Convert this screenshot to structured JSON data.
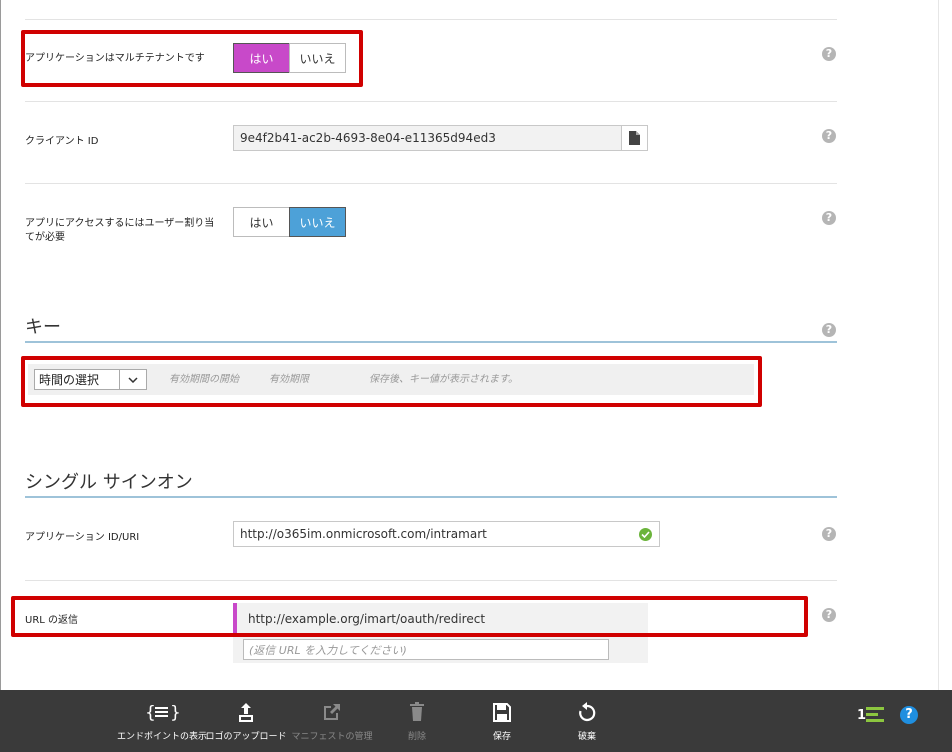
{
  "multitenant": {
    "label": "アプリケーションはマルチテナントです",
    "yes": "はい",
    "no": "いいえ"
  },
  "client_id": {
    "label": "クライアント ID",
    "value": "9e4f2b41-ac2b-4693-8e04-e11365d94ed3"
  },
  "user_assignment": {
    "label_line1": "アプリにアクセスするにはユーザー割り当",
    "label_line2": "てが必要",
    "yes": "はい",
    "no": "いいえ"
  },
  "keys": {
    "title": "キー",
    "duration_select": "時間の選択",
    "valid_from": "有効期間の開始",
    "valid_to": "有効期限",
    "value_hint": "保存後、キー値が表示されます。"
  },
  "sso": {
    "title": "シングル サインオン",
    "app_id_label": "アプリケーション ID/URI",
    "app_id_value": "http://o365im.onmicrosoft.com/intramart",
    "reply_url_label": "URL の返信",
    "reply_url_value": "http://example.org/imart/oauth/redirect",
    "reply_url_placeholder": "(返信 URL を入力してください)"
  },
  "help_glyph": "?",
  "toolbar": {
    "endpoints": "エンドポイントの表示",
    "upload_logo": "ロゴのアップロード",
    "manage_manifest": "マニフェストの管理",
    "delete": "削除",
    "save": "保存",
    "discard": "破棄",
    "count": "1"
  },
  "colors": {
    "accent_pink": "#c849c9",
    "accent_blue": "#4da1d8",
    "highlight_red": "#d00000",
    "toolbar_bg": "#3a3a3a"
  }
}
